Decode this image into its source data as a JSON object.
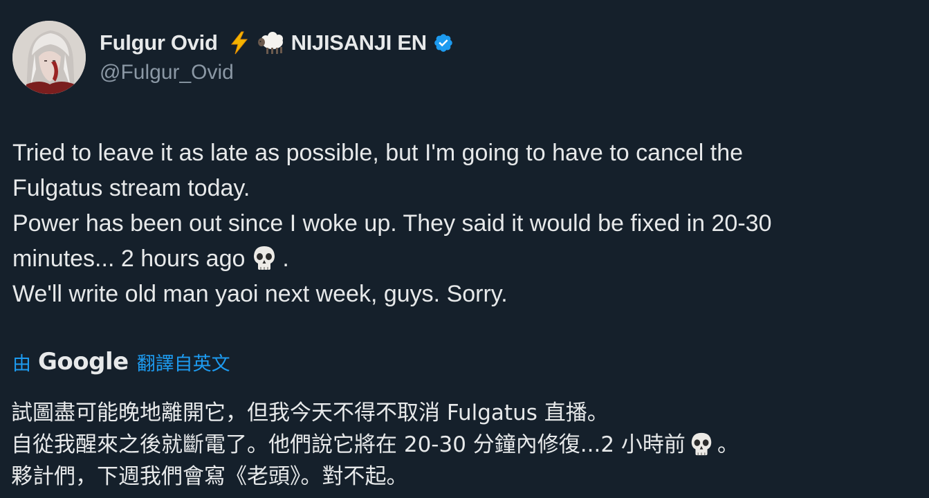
{
  "author": {
    "display_name": "Fulgur Ovid",
    "org_name": "NIJISANJI EN",
    "handle": "@Fulgur_Ovid",
    "verified": true,
    "emojis": [
      "lightning-emoji",
      "sheep-emoji"
    ]
  },
  "tweet": {
    "line1": "Tried to leave it as late as possible, but I'm going to have to cancel the",
    "line2": "Fulgatus stream today.",
    "line3": "Power has been out since I woke up. They said it would be fixed in 20-30",
    "line4_before": "minutes... 2 hours ago",
    "line4_after": ".",
    "line5": "We'll write old man yaoi next week, guys. Sorry."
  },
  "translation": {
    "prefix": "由",
    "provider": "Google",
    "suffix": "翻譯自英文",
    "line1": "試圖盡可能晚地離開它，但我今天不得不取消 Fulgatus 直播。",
    "line2_before": "自從我醒來之後就斷電了。他們說它將在 20-30 分鐘內修復...2 小時前",
    "line2_after": "。",
    "line3": "夥計們，下週我們會寫《老頭》。對不起。"
  },
  "colors": {
    "background": "#15202b",
    "text": "#e7e9ea",
    "secondary": "#8b98a5",
    "accent": "#1d9bf0"
  }
}
